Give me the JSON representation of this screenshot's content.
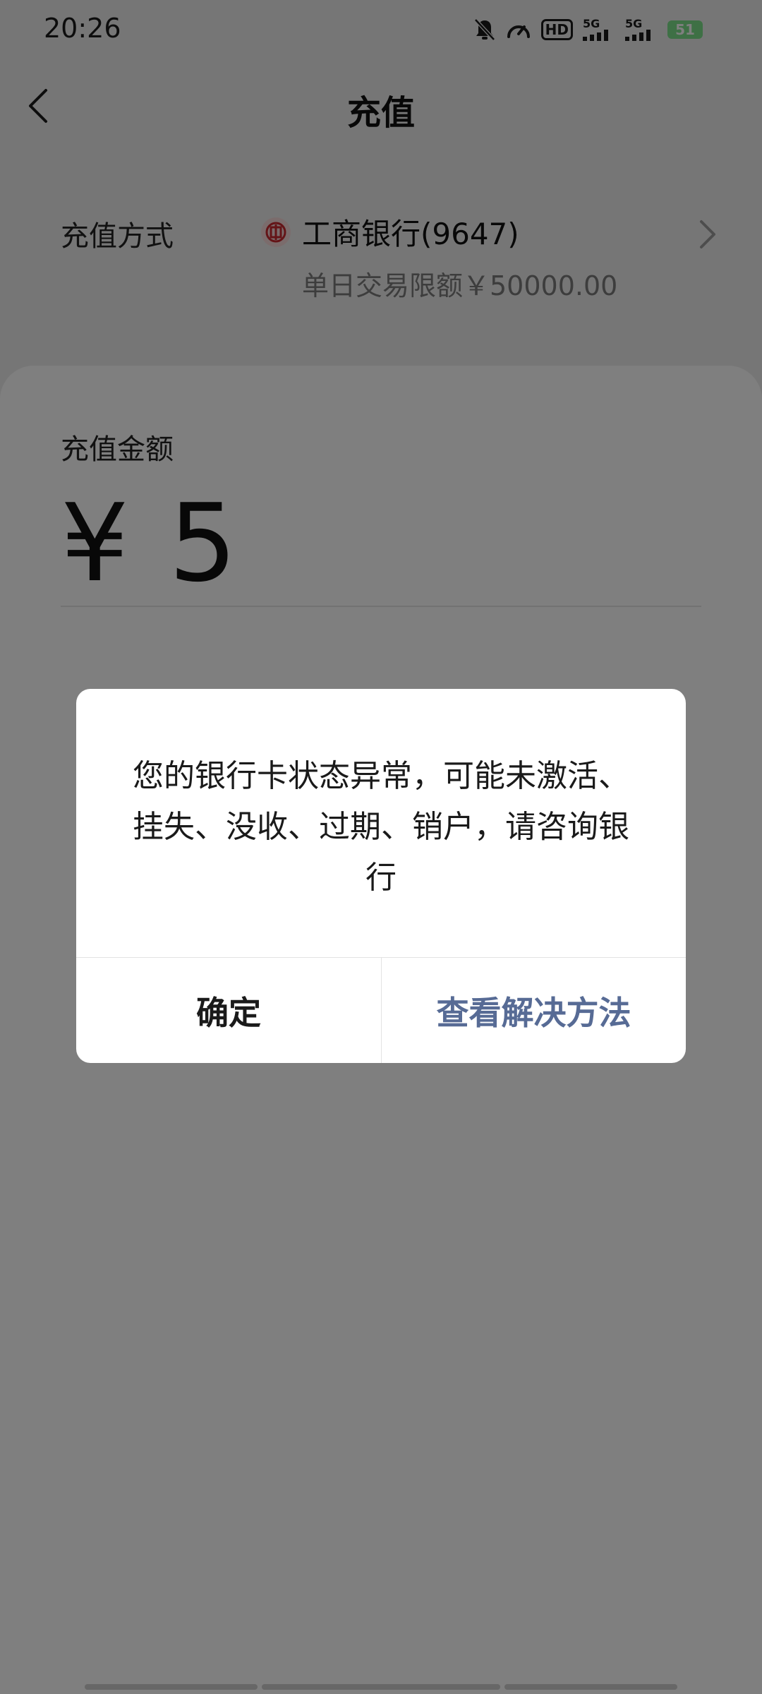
{
  "status_bar": {
    "time": "20:26",
    "hd_label": "HD",
    "sim1_label": "5G",
    "sim2_label": "5G",
    "battery_level": "51"
  },
  "nav": {
    "title": "充值"
  },
  "recharge_method": {
    "label": "充值方式",
    "bank_name": "工商银行(9647)",
    "daily_limit": "单日交易限额￥50000.00"
  },
  "amount": {
    "label": "充值金额",
    "value": "¥ 5"
  },
  "dialog": {
    "message": "您的银行卡状态异常，可能未激活、挂失、没收、过期、销户，请咨询银行",
    "confirm_label": "确定",
    "solution_label": "查看解决方法"
  },
  "colors": {
    "accent": "#576b95",
    "bank_icon": "#c8292f",
    "battery": "#7ce08a"
  },
  "icons": {
    "back": "chevron-left-icon",
    "forward": "chevron-right-icon",
    "bank": "icbc-bank-icon",
    "mute": "bell-off-icon",
    "speed": "speedometer-icon"
  }
}
